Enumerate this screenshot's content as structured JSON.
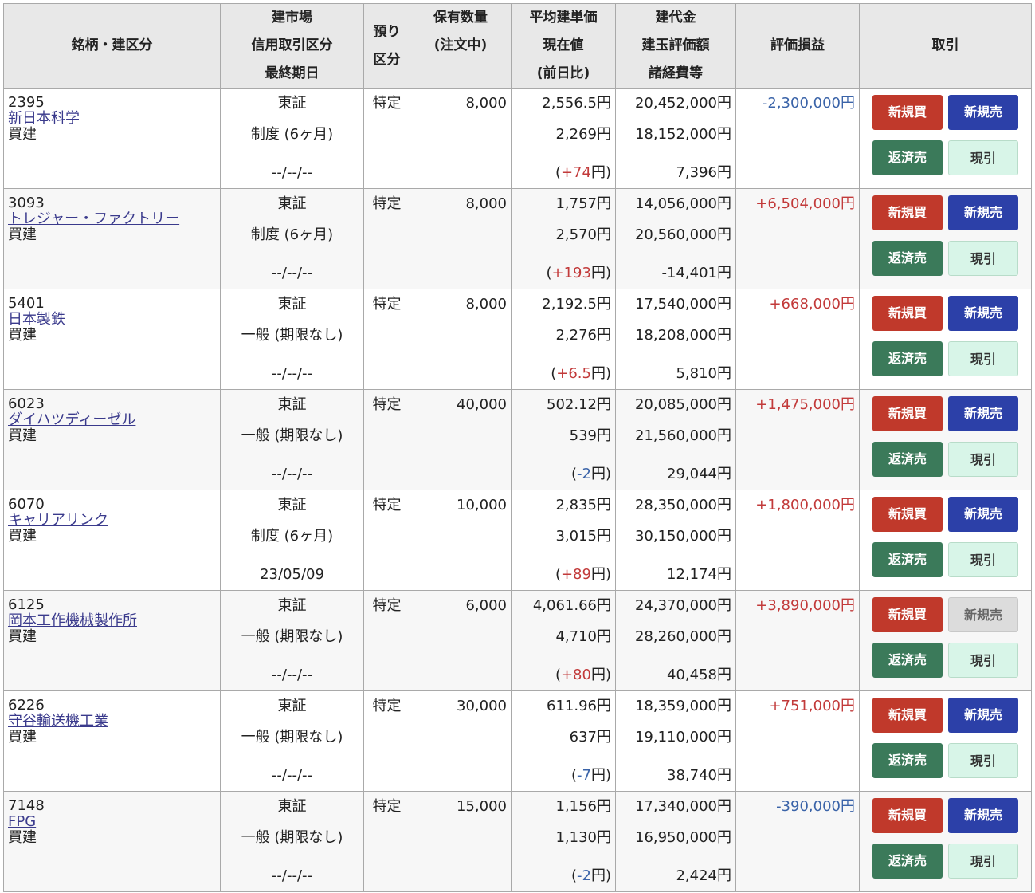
{
  "headers": {
    "name": "銘柄・建区分",
    "market": [
      "建市場",
      "信用取引区分",
      "最終期日"
    ],
    "account": [
      "預り",
      "区分"
    ],
    "qty": [
      "保有数量",
      "(注文中)"
    ],
    "price": [
      "平均建単価",
      "現在値",
      "(前日比)"
    ],
    "amount": [
      "建代金",
      "建玉評価額",
      "諸経費等"
    ],
    "pl": "評価損益",
    "trade": "取引"
  },
  "buttons": {
    "buy": "新規買",
    "sell": "新規売",
    "close": "返済売",
    "deliver": "現引"
  },
  "colors": {
    "buy": "#c0392b",
    "sell": "#2c40a8",
    "close": "#3b7a5a",
    "deliver": "#d8f5e8",
    "gain": "#c23a3a",
    "loss": "#3a63a8"
  },
  "rows": [
    {
      "code": "2395",
      "name": "新日本科学",
      "side": "買建",
      "market": "東証",
      "credit": "制度 (6ヶ月)",
      "due": "--/--/--",
      "account": "特定",
      "qty": "8,000",
      "avg": "2,556.5円",
      "current": "2,269円",
      "change_open": "(",
      "change": "+74",
      "change_close": "円)",
      "cost": "20,452,000円",
      "value": "18,152,000円",
      "fees": "7,396円",
      "pl": "-2,300,000円",
      "pl_sign": "neg",
      "change_sign": "pos",
      "sell_enabled": true
    },
    {
      "code": "3093",
      "name": "トレジャー・ファクトリー",
      "side": "買建",
      "market": "東証",
      "credit": "制度 (6ヶ月)",
      "due": "--/--/--",
      "account": "特定",
      "qty": "8,000",
      "avg": "1,757円",
      "current": "2,570円",
      "change_open": "(",
      "change": "+193",
      "change_close": "円)",
      "cost": "14,056,000円",
      "value": "20,560,000円",
      "fees": "-14,401円",
      "pl": "+6,504,000円",
      "pl_sign": "pos",
      "change_sign": "pos",
      "sell_enabled": true
    },
    {
      "code": "5401",
      "name": "日本製鉄",
      "side": "買建",
      "market": "東証",
      "credit": "一般 (期限なし)",
      "due": "--/--/--",
      "account": "特定",
      "qty": "8,000",
      "avg": "2,192.5円",
      "current": "2,276円",
      "change_open": "(",
      "change": "+6.5",
      "change_close": "円)",
      "cost": "17,540,000円",
      "value": "18,208,000円",
      "fees": "5,810円",
      "pl": "+668,000円",
      "pl_sign": "pos",
      "change_sign": "pos",
      "sell_enabled": true
    },
    {
      "code": "6023",
      "name": "ダイハツディーゼル",
      "side": "買建",
      "market": "東証",
      "credit": "一般 (期限なし)",
      "due": "--/--/--",
      "account": "特定",
      "qty": "40,000",
      "avg": "502.12円",
      "current": "539円",
      "change_open": "(",
      "change": "-2",
      "change_close": "円)",
      "cost": "20,085,000円",
      "value": "21,560,000円",
      "fees": "29,044円",
      "pl": "+1,475,000円",
      "pl_sign": "pos",
      "change_sign": "neg",
      "sell_enabled": true
    },
    {
      "code": "6070",
      "name": "キャリアリンク",
      "side": "買建",
      "market": "東証",
      "credit": "制度 (6ヶ月)",
      "due": "23/05/09",
      "account": "特定",
      "qty": "10,000",
      "avg": "2,835円",
      "current": "3,015円",
      "change_open": "(",
      "change": "+89",
      "change_close": "円)",
      "cost": "28,350,000円",
      "value": "30,150,000円",
      "fees": "12,174円",
      "pl": "+1,800,000円",
      "pl_sign": "pos",
      "change_sign": "pos",
      "sell_enabled": true
    },
    {
      "code": "6125",
      "name": "岡本工作機械製作所",
      "side": "買建",
      "market": "東証",
      "credit": "一般 (期限なし)",
      "due": "--/--/--",
      "account": "特定",
      "qty": "6,000",
      "avg": "4,061.66円",
      "current": "4,710円",
      "change_open": "(",
      "change": "+80",
      "change_close": "円)",
      "cost": "24,370,000円",
      "value": "28,260,000円",
      "fees": "40,458円",
      "pl": "+3,890,000円",
      "pl_sign": "pos",
      "change_sign": "pos",
      "sell_enabled": false
    },
    {
      "code": "6226",
      "name": "守谷輸送機工業",
      "side": "買建",
      "market": "東証",
      "credit": "一般 (期限なし)",
      "due": "--/--/--",
      "account": "特定",
      "qty": "30,000",
      "avg": "611.96円",
      "current": "637円",
      "change_open": "(",
      "change": "-7",
      "change_close": "円)",
      "cost": "18,359,000円",
      "value": "19,110,000円",
      "fees": "38,740円",
      "pl": "+751,000円",
      "pl_sign": "pos",
      "change_sign": "neg",
      "sell_enabled": true
    },
    {
      "code": "7148",
      "name": "FPG",
      "side": "買建",
      "market": "東証",
      "credit": "一般 (期限なし)",
      "due": "--/--/--",
      "account": "特定",
      "qty": "15,000",
      "avg": "1,156円",
      "current": "1,130円",
      "change_open": "(",
      "change": "-2",
      "change_close": "円)",
      "cost": "17,340,000円",
      "value": "16,950,000円",
      "fees": "2,424円",
      "pl": "-390,000円",
      "pl_sign": "neg",
      "change_sign": "neg",
      "sell_enabled": true
    }
  ]
}
